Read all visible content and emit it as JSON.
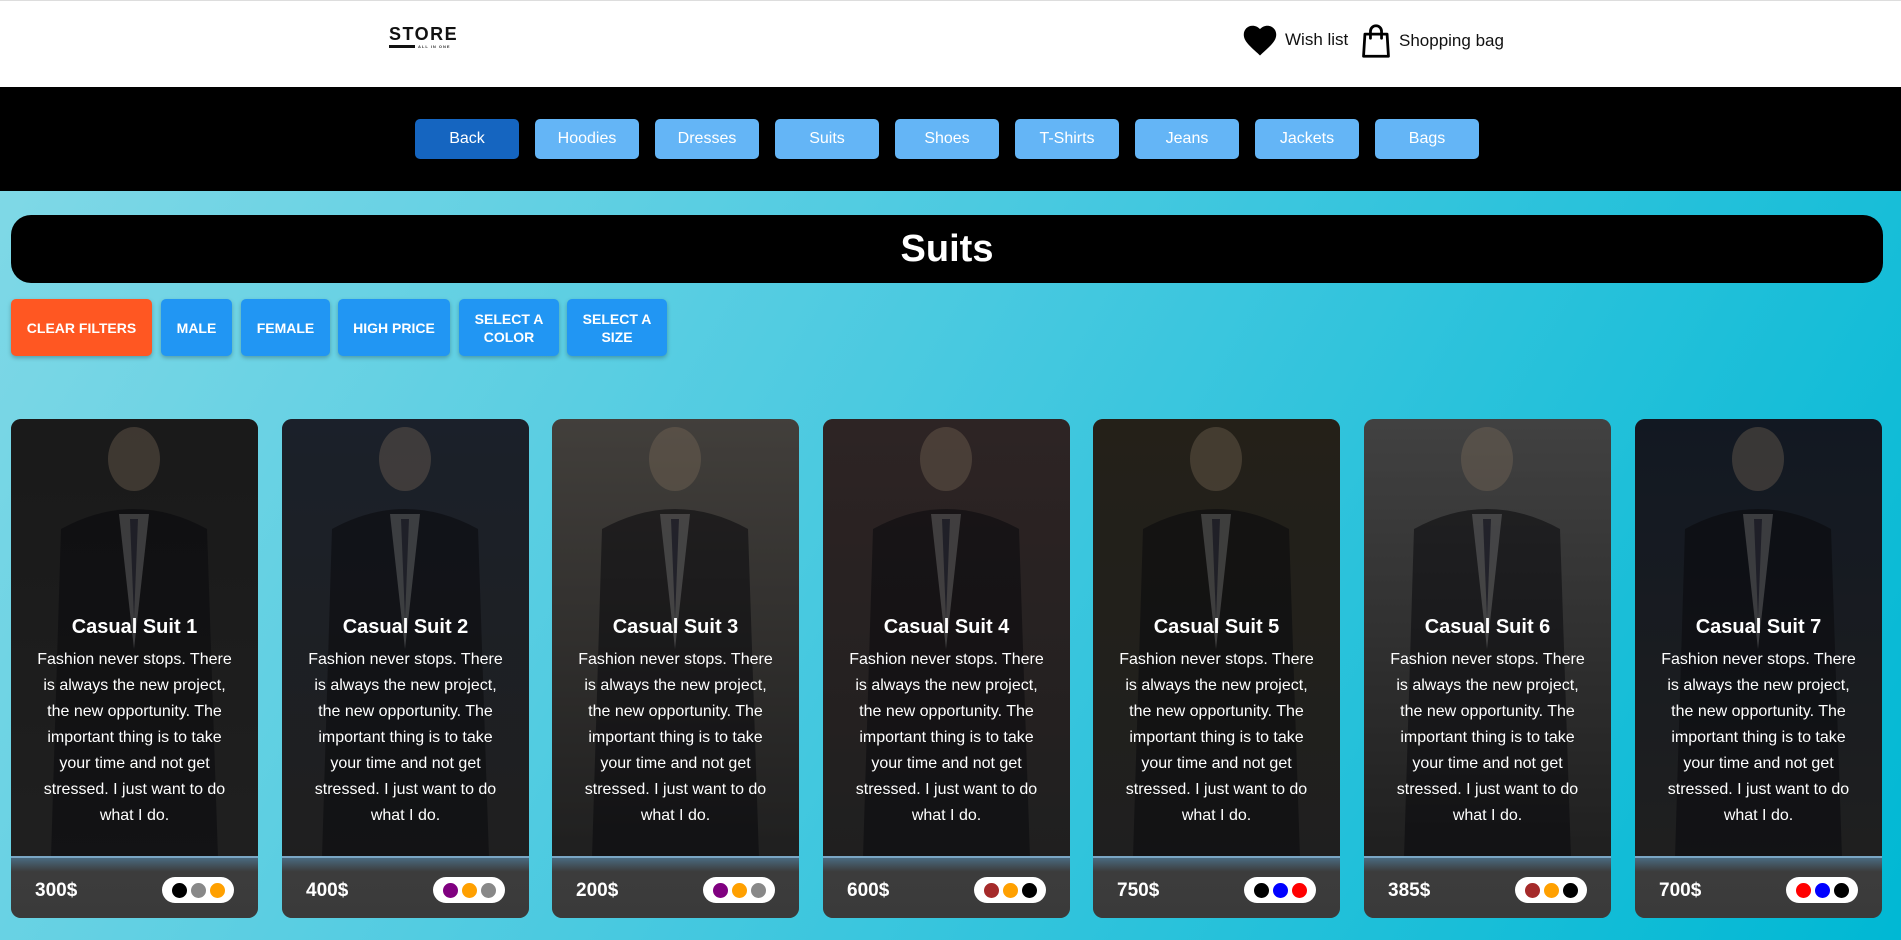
{
  "header": {
    "logo_text": "STORE",
    "logo_sub": "ALL IN ONE",
    "wishlist_label": "Wish list",
    "bag_label": "Shopping bag"
  },
  "nav": {
    "items": [
      "Back",
      "Hoodies",
      "Dresses",
      "Suits",
      "Shoes",
      "T-Shirts",
      "Jeans",
      "Jackets",
      "Bags"
    ],
    "active": "Back"
  },
  "page": {
    "title": "Suits"
  },
  "filters": [
    "Clear Filters",
    "Male",
    "Female",
    "High Price",
    "Select a Color",
    "Select a Size"
  ],
  "colors": {
    "accent": "#2196f3",
    "clear": "#ff5722",
    "nav_button": "#64b5f6",
    "nav_active": "#1565c0"
  },
  "products": [
    {
      "name": "Casual Suit 1",
      "description": "Fashion never stops. There is always the new project, the new opportunity. The important thing is to take your time and not get stressed. I just want to do what I do.",
      "price": "300$",
      "swatches": [
        "#000000",
        "#888888",
        "#ffa000"
      ],
      "tone": "#2a2a2a"
    },
    {
      "name": "Casual Suit 2",
      "description": "Fashion never stops. There is always the new project, the new opportunity. The important thing is to take your time and not get stressed. I just want to do what I do.",
      "price": "400$",
      "swatches": [
        "#800080",
        "#ffa000",
        "#888888"
      ],
      "tone": "#2c3444"
    },
    {
      "name": "Casual Suit 3",
      "description": "Fashion never stops. There is always the new project, the new opportunity. The important thing is to take your time and not get stressed. I just want to do what I do.",
      "price": "200$",
      "swatches": [
        "#800080",
        "#ffa000",
        "#888888"
      ],
      "tone": "#6b6660"
    },
    {
      "name": "Casual Suit 4",
      "description": "Fashion never stops. There is always the new project, the new opportunity. The important thing is to take your time and not get stressed. I just want to do what I do.",
      "price": "600$",
      "swatches": [
        "#a52a2a",
        "#ffa000",
        "#000000"
      ],
      "tone": "#4a3a3a"
    },
    {
      "name": "Casual Suit 5",
      "description": "Fashion never stops. There is always the new project, the new opportunity. The important thing is to take your time and not get stressed. I just want to do what I do.",
      "price": "750$",
      "swatches": [
        "#000000",
        "#0000ff",
        "#ff0000"
      ],
      "tone": "#3a3528"
    },
    {
      "name": "Casual Suit 6",
      "description": "Fashion never stops. There is always the new project, the new opportunity. The important thing is to take your time and not get stressed. I just want to do what I do.",
      "price": "385$",
      "swatches": [
        "#a52a2a",
        "#ffa000",
        "#000000"
      ],
      "tone": "#6a6a6a"
    },
    {
      "name": "Casual Suit 7",
      "description": "Fashion never stops. There is always the new project, the new opportunity. The important thing is to take your time and not get stressed. I just want to do what I do.",
      "price": "700$",
      "swatches": [
        "#ff0000",
        "#0000ff",
        "#000000"
      ],
      "tone": "#1e2838"
    }
  ]
}
